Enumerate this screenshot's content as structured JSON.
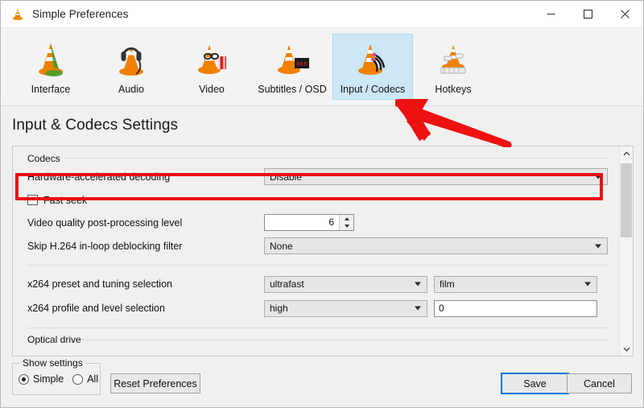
{
  "window": {
    "title": "Simple Preferences",
    "icon": "vlc-cone-icon",
    "controls": {
      "minimize": "minimize-icon",
      "maximize": "maximize-icon",
      "close": "close-icon"
    }
  },
  "toolbar": {
    "tabs": [
      {
        "label": "Interface",
        "icon": "vlc-cone-interface-icon",
        "selected": false
      },
      {
        "label": "Audio",
        "icon": "vlc-cone-headphones-icon",
        "selected": false
      },
      {
        "label": "Video",
        "icon": "vlc-cone-video-icon",
        "selected": false
      },
      {
        "label": "Subtitles / OSD",
        "icon": "vlc-cone-subtitles-icon",
        "selected": false
      },
      {
        "label": "Input / Codecs",
        "icon": "vlc-cone-input-codecs-icon",
        "selected": true
      },
      {
        "label": "Hotkeys",
        "icon": "vlc-cone-hotkeys-icon",
        "selected": false
      }
    ]
  },
  "page": {
    "title": "Input & Codecs Settings"
  },
  "settings": {
    "codecs_group": "Codecs",
    "optical_group": "Optical drive",
    "rows": {
      "hardware_decoding": {
        "label": "Hardware-accelerated decoding",
        "value": "Disable"
      },
      "fast_seek": {
        "label": "Fast seek",
        "checked": false
      },
      "post_processing": {
        "label": "Video quality post-processing level",
        "value": "6"
      },
      "deblocking": {
        "label": "Skip H.264 in-loop deblocking filter",
        "value": "None"
      },
      "x264_preset": {
        "label": "x264 preset and tuning selection",
        "preset": "ultrafast",
        "tuning": "film"
      },
      "x264_profile": {
        "label": "x264 profile and level selection",
        "profile": "high",
        "level": "0"
      }
    }
  },
  "scrollbar": {
    "up": "chevron-up-icon",
    "down": "chevron-down-icon"
  },
  "footer": {
    "show_settings_legend": "Show settings",
    "radio_simple": "Simple",
    "radio_all": "All",
    "selected_mode": "Simple",
    "reset_label": "Reset Preferences",
    "save_label": "Save",
    "cancel_label": "Cancel"
  },
  "annotations": {
    "highlight_color": "#ee1111",
    "highlight_target": "Hardware-accelerated decoding",
    "arrow_target": "Input / Codecs"
  },
  "colors": {
    "accent": "#0078d7",
    "selection": "#cce8f7",
    "annotation": "#ee1111",
    "window_bg": "#f0f0f0"
  }
}
